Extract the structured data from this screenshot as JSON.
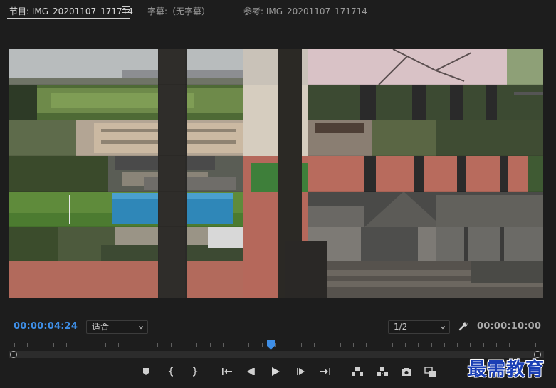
{
  "tabs": [
    {
      "label": "节目: IMG_20201107_171714",
      "active": true
    },
    {
      "label": "字幕:（无字幕）",
      "active": false
    },
    {
      "label": "参考: IMG_20201107_171714",
      "active": false
    }
  ],
  "timecode": {
    "current": "00:00:04:24",
    "duration": "00:00:10:00"
  },
  "zoom": {
    "selected": "适合"
  },
  "resolution": {
    "selected": "1/2"
  },
  "playhead": {
    "position_fraction": 0.49
  },
  "icons": {
    "menu": "hamburger-icon",
    "settings": "wrench-icon",
    "transport": [
      "add-marker-icon",
      "mark-in-icon",
      "mark-out-icon",
      "go-to-in-icon",
      "step-back-icon",
      "play-icon",
      "step-forward-icon",
      "go-to-out-icon",
      "lift-icon",
      "extract-icon",
      "export-frame-icon",
      "compare-view-icon"
    ]
  },
  "colors": {
    "accent_timecode": "#3e8ee6",
    "playhead": "#3e8ee6"
  },
  "watermark": {
    "text": "最需教育"
  }
}
